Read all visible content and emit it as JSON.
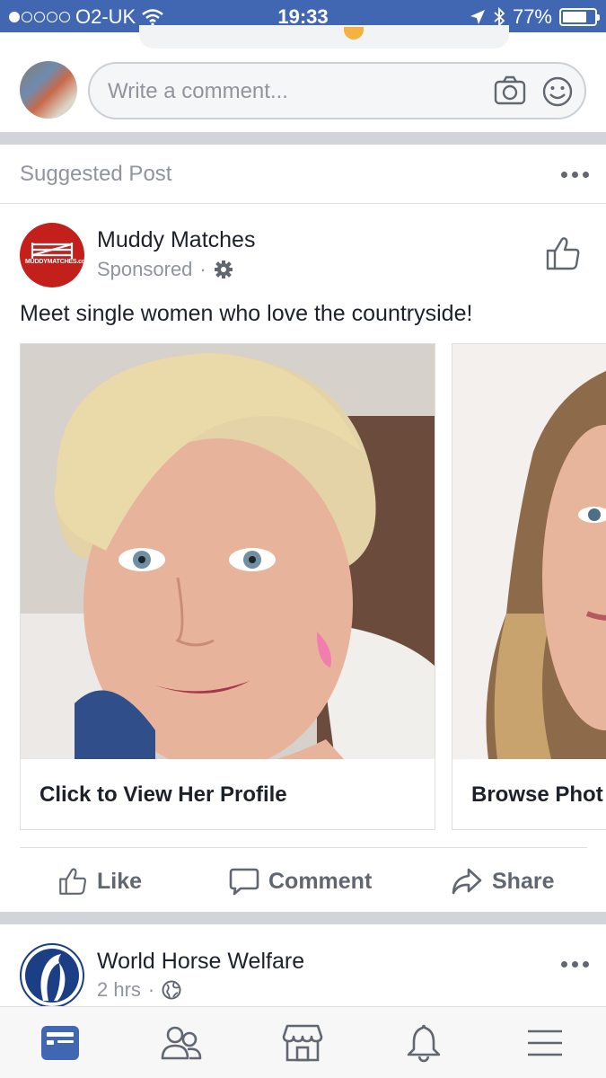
{
  "status_bar": {
    "carrier": "O2-UK",
    "time": "19:33",
    "battery": "77%",
    "battery_level": 0.77
  },
  "comment_composer": {
    "placeholder": "Write a comment..."
  },
  "suggested_header": {
    "label": "Suggested Post"
  },
  "sponsored_post": {
    "page_name": "Muddy Matches",
    "meta": "Sponsored",
    "meta_separator": "·",
    "logo_text": "MUDDYMATCHES.co.uk",
    "caption": "Meet single women who love the countryside!",
    "cards": [
      {
        "cta": "Click to View Her Profile"
      },
      {
        "cta": "Browse Phot"
      }
    ],
    "actions": {
      "like": "Like",
      "comment": "Comment",
      "share": "Share"
    }
  },
  "next_post": {
    "page_name": "World Horse Welfare",
    "time": "2 hrs",
    "meta_separator": "·"
  },
  "tab_bar": {
    "tabs": [
      "news-feed",
      "friends",
      "marketplace",
      "notifications",
      "menu"
    ],
    "active": "news-feed"
  },
  "colors": {
    "brand_blue": "#4267b2",
    "text_primary": "#1d2129",
    "text_secondary": "#90949c",
    "muddy_red": "#c4201b",
    "whw_navy": "#1c3e85"
  }
}
